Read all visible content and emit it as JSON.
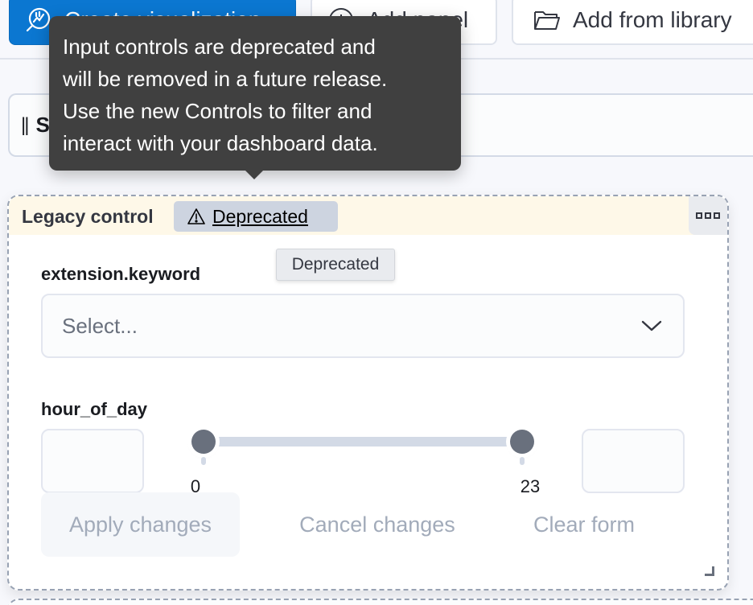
{
  "toolbar": {
    "create_visualization_label": "Create visualization",
    "add_panel_label": "Add panel",
    "add_from_library_label": "Add from library",
    "primary_color": "#0b77d1"
  },
  "controls_bar": {
    "drag_handle": "||",
    "label": "S"
  },
  "panel": {
    "title": "Legacy control",
    "badge": {
      "icon": "warning-icon",
      "label": "Deprecated"
    },
    "menu_icon": "panel-options-icon",
    "fields": [
      {
        "label": "extension.keyword",
        "type": "select",
        "placeholder": "Select...",
        "value": ""
      },
      {
        "label": "hour_of_day",
        "type": "range",
        "min": 0,
        "max": 23,
        "lower_value": 0,
        "upper_value": 23,
        "min_input_value": "",
        "max_input_value": "",
        "tick_labels": [
          "0",
          "23"
        ]
      }
    ],
    "actions": {
      "apply": "Apply changes",
      "cancel": "Cancel changes",
      "clear": "Clear form"
    },
    "header_color": "#fef8e8"
  },
  "tooltips": {
    "main_lines": [
      "Input controls are deprecated and",
      "will be removed in a future release.",
      "Use the new Controls to filter and",
      "interact with your dashboard data."
    ],
    "badge_tooltip": "Deprecated"
  }
}
